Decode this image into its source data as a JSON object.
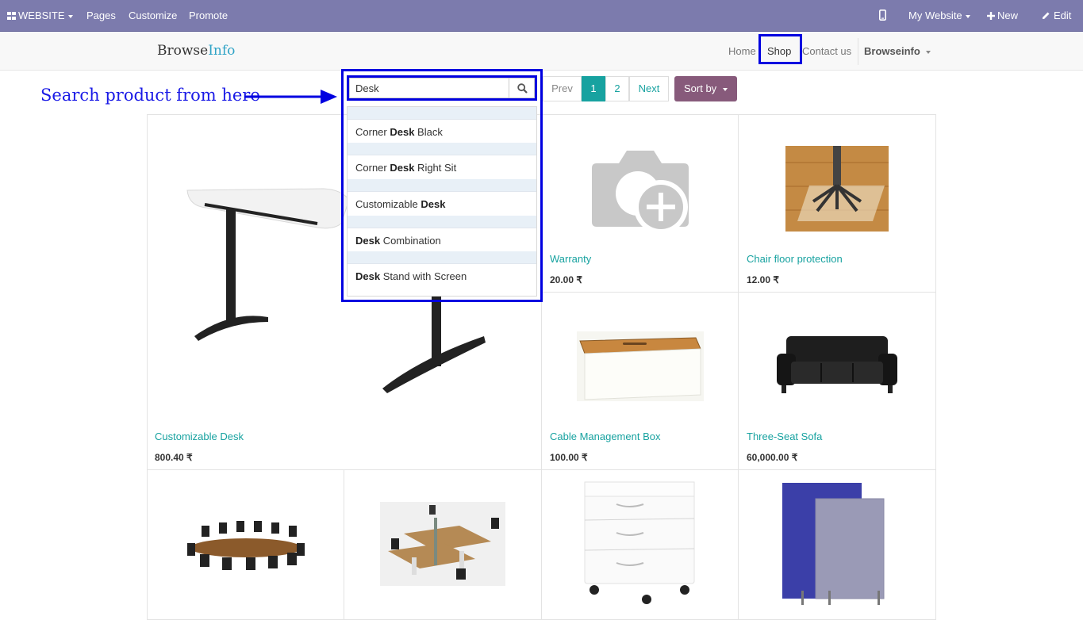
{
  "admin_bar": {
    "website_label": "WEBSITE",
    "menu": [
      "Pages",
      "Customize",
      "Promote"
    ],
    "site_selector": "My Website",
    "new_label": "New",
    "edit_label": "Edit"
  },
  "site": {
    "logo_part1": "Browse",
    "logo_part2": "Info",
    "nav": [
      "Home",
      "Shop",
      "Contact us"
    ],
    "user": "Browseinfo"
  },
  "annotation": "Search product from here",
  "search": {
    "value": "Desk",
    "suggestions": [
      {
        "pre": "Corner ",
        "match": "Desk",
        "post": " Black"
      },
      {
        "pre": "Corner ",
        "match": "Desk",
        "post": " Right Sit"
      },
      {
        "pre": "Customizable ",
        "match": "Desk",
        "post": ""
      },
      {
        "pre": "",
        "match": "Desk",
        "post": " Combination"
      },
      {
        "pre": "",
        "match": "Desk",
        "post": " Stand with Screen"
      }
    ]
  },
  "pager": {
    "prev": "Prev",
    "pages": [
      "1",
      "2"
    ],
    "next": "Next",
    "sort_label": "Sort by"
  },
  "products": [
    {
      "name": "Customizable Desk",
      "price": "800.40 ₹"
    },
    {
      "name": "Warranty",
      "price": "20.00 ₹"
    },
    {
      "name": "Chair floor protection",
      "price": "12.00 ₹"
    },
    {
      "name": "Cable Management Box",
      "price": "100.00 ₹"
    },
    {
      "name": "Three-Seat Sofa",
      "price": "60,000.00 ₹"
    }
  ],
  "colors": {
    "admin_bar": "#7c7bad",
    "accent": "#17a2a0",
    "sort_button": "#875a7b",
    "highlight": "#0000e0"
  }
}
